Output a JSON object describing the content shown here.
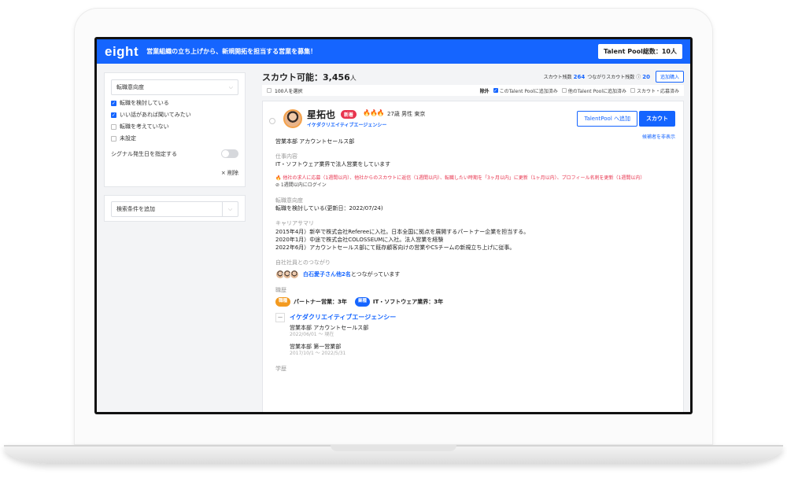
{
  "header": {
    "logo": "eight",
    "title": "営業組織の立ち上げから、新規開拓を担当する営業を募集！",
    "pool_total": "Talent Pool総数：10人"
  },
  "sidebar": {
    "filter_select": "転職意向度",
    "options": [
      {
        "label": "転職を検討している",
        "checked": true
      },
      {
        "label": "いい話があれば聞いてみたい",
        "checked": true
      },
      {
        "label": "転職を考えていない",
        "checked": false
      },
      {
        "label": "未設定",
        "checked": false
      }
    ],
    "signal_label": "シグナル発生日を指定する",
    "delete_label": "× 削除",
    "add_condition": "検索条件を追加"
  },
  "main": {
    "scout_available_label": "スカウト可能：3,456",
    "scout_unit": "人",
    "remaining_label": "スカウト残数",
    "remaining_value": "264",
    "connect_label": "つながりスカウト残数",
    "connect_value": "20",
    "buy_button": "追加購入",
    "select_100": "100人を選択",
    "exclude_label": "除外",
    "exclude_opts": [
      {
        "label": "このTalent Poolに追加済み",
        "checked": true
      },
      {
        "label": "他のTalent Poolに追加済み",
        "checked": false
      },
      {
        "label": "スカウト・応募済み",
        "checked": false
      }
    ]
  },
  "candidate": {
    "name": "星拓也",
    "new_badge": "新着",
    "flames": "🔥🔥🔥",
    "meta": "27歳  男性  東京",
    "company": "イケダクリエイティブエージェンシー",
    "add_pool_button": "TalentPool へ追加",
    "scout_button": "スカウト",
    "hide_link": "候補者を非表示",
    "department": "営業本部 アカウントセールス部",
    "job_label": "仕事内容",
    "job_text": "IT・ソフトウェア業界で法人営業をしています",
    "warning": "🔥 他社の求人に応募（1週間以内）、他社からのスカウトに返信（1週間以内）、転職したい時期を「3ヶ月以内」に更新（1ヶ月以内）、プロフィール名刺を更新（1週間以内）",
    "login": "⊘ 1週間以内にログイン",
    "intent_label": "転職意向度",
    "intent_text": "転職を検討している(更新日：2022/07/24)",
    "career_label": "キャリアサマリ",
    "career": [
      "2015年4月）新卒で株式会社Refereeに入社。日本全国に拠点を展開するパートナー企業を担当する。",
      "2020年1月）中途で株式会社COLOSSEUMに入社。法人営業を経験",
      "2022年6月）アカウントセールス部にて既存顧客向けの営業やCSチームの新規立ち上げに従事。"
    ],
    "connection_label": "自社社員とのつながり",
    "connection_link": "白石愛子さん他2名",
    "connection_text": "とつながっています",
    "history_label": "職歴",
    "skill1_tag": "職種",
    "skill1": "パートナー営業：3年",
    "skill2_tag": "業種",
    "skill2": "IT・ソフトウェア業界：3年",
    "history_company": "イケダクリエイティブエージェンシー",
    "history": [
      {
        "dept": "営業本部 アカウントセールス部",
        "date": "2022/06/01 〜 現在"
      },
      {
        "dept": "営業本部 第一営業部",
        "date": "2017/10/1 〜 2022/5/31"
      }
    ],
    "education_label": "学歴"
  }
}
